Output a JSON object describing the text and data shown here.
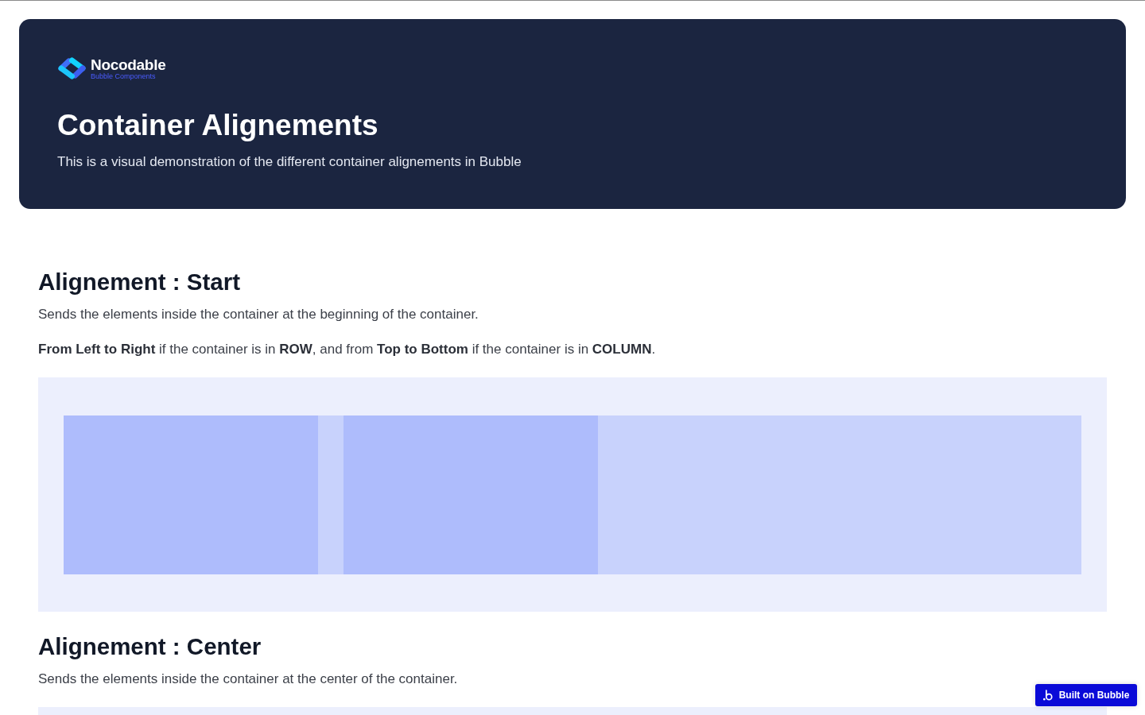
{
  "header": {
    "logo": {
      "name": "Nocodable",
      "tagline": "Bubble Components"
    },
    "title": "Container Alignements",
    "subtitle": "This is a visual demonstration of the different container alignements in Bubble"
  },
  "sections": [
    {
      "heading": "Alignement : Start",
      "paragraphs": [
        "Sends the elements inside the container at the beginning of the container.",
        "**From Left to Right** if the container is in **ROW**, and from **Top to Bottom** if the container is in **COLUMN**."
      ],
      "demo": {
        "kind": "start",
        "blocks": [
          {
            "kind": "block"
          },
          {
            "kind": "block"
          }
        ]
      }
    },
    {
      "heading": "Alignement : Center",
      "paragraphs": [
        "Sends the elements inside the container at the center of the container."
      ],
      "demo": {
        "kind": "center"
      }
    }
  ],
  "badge": {
    "label": "Built on Bubble"
  }
}
